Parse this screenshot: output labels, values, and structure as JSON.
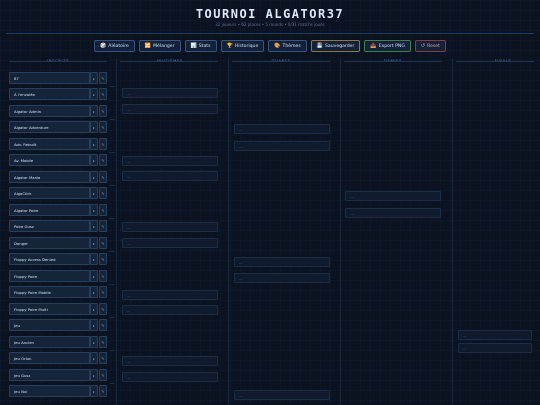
{
  "header": {
    "title": "TOURNOI ALGATOR37",
    "subtitle": "32 joueurs • 62 places • 5 rounds • 0/31 matchs joués"
  },
  "toolbar": [
    {
      "icon": "🎲",
      "label": "Aléatoire",
      "name": "random-button",
      "cls": ""
    },
    {
      "icon": "🔀",
      "label": "Mélanger",
      "name": "shuffle-button",
      "cls": ""
    },
    {
      "icon": "📊",
      "label": "Stats",
      "name": "stats-button",
      "cls": ""
    },
    {
      "icon": "🏆",
      "label": "Historique",
      "name": "history-button",
      "cls": ""
    },
    {
      "icon": "🎨",
      "label": "Thèmes",
      "name": "themes-button",
      "cls": ""
    },
    {
      "icon": "💾",
      "label": "Sauvegarder",
      "name": "save-button",
      "cls": "save"
    },
    {
      "icon": "📤",
      "label": "Export PNG",
      "name": "export-png-button",
      "cls": "export"
    },
    {
      "icon": "↺",
      "label": "Reset",
      "name": "reset-button",
      "cls": "reset"
    }
  ],
  "columns": [
    "Inscrits",
    "Huitièmes",
    "Quarts",
    "Demies",
    "Finale"
  ],
  "entries": [
    "87",
    "A l'envolée",
    "Algator Admin",
    "Algator Adventure",
    "Adv. Rebuilt",
    "Av. Mobile",
    "Algator Mania",
    "AlgoClick",
    "Algator Poire",
    "Poire Gusz",
    "Danger",
    "Floppy Access Denied",
    "Floppy Poire",
    "Floppy Poire Mobile",
    "Floppy Poire Multi",
    "Jeu",
    "Jeu Ancien",
    "Jeu Orion",
    "Jeu Gusz",
    "Jeu Nul"
  ],
  "entry_controls": {
    "advance_symbol": "▸",
    "edit_symbol": "✎"
  },
  "slot_text": "—"
}
